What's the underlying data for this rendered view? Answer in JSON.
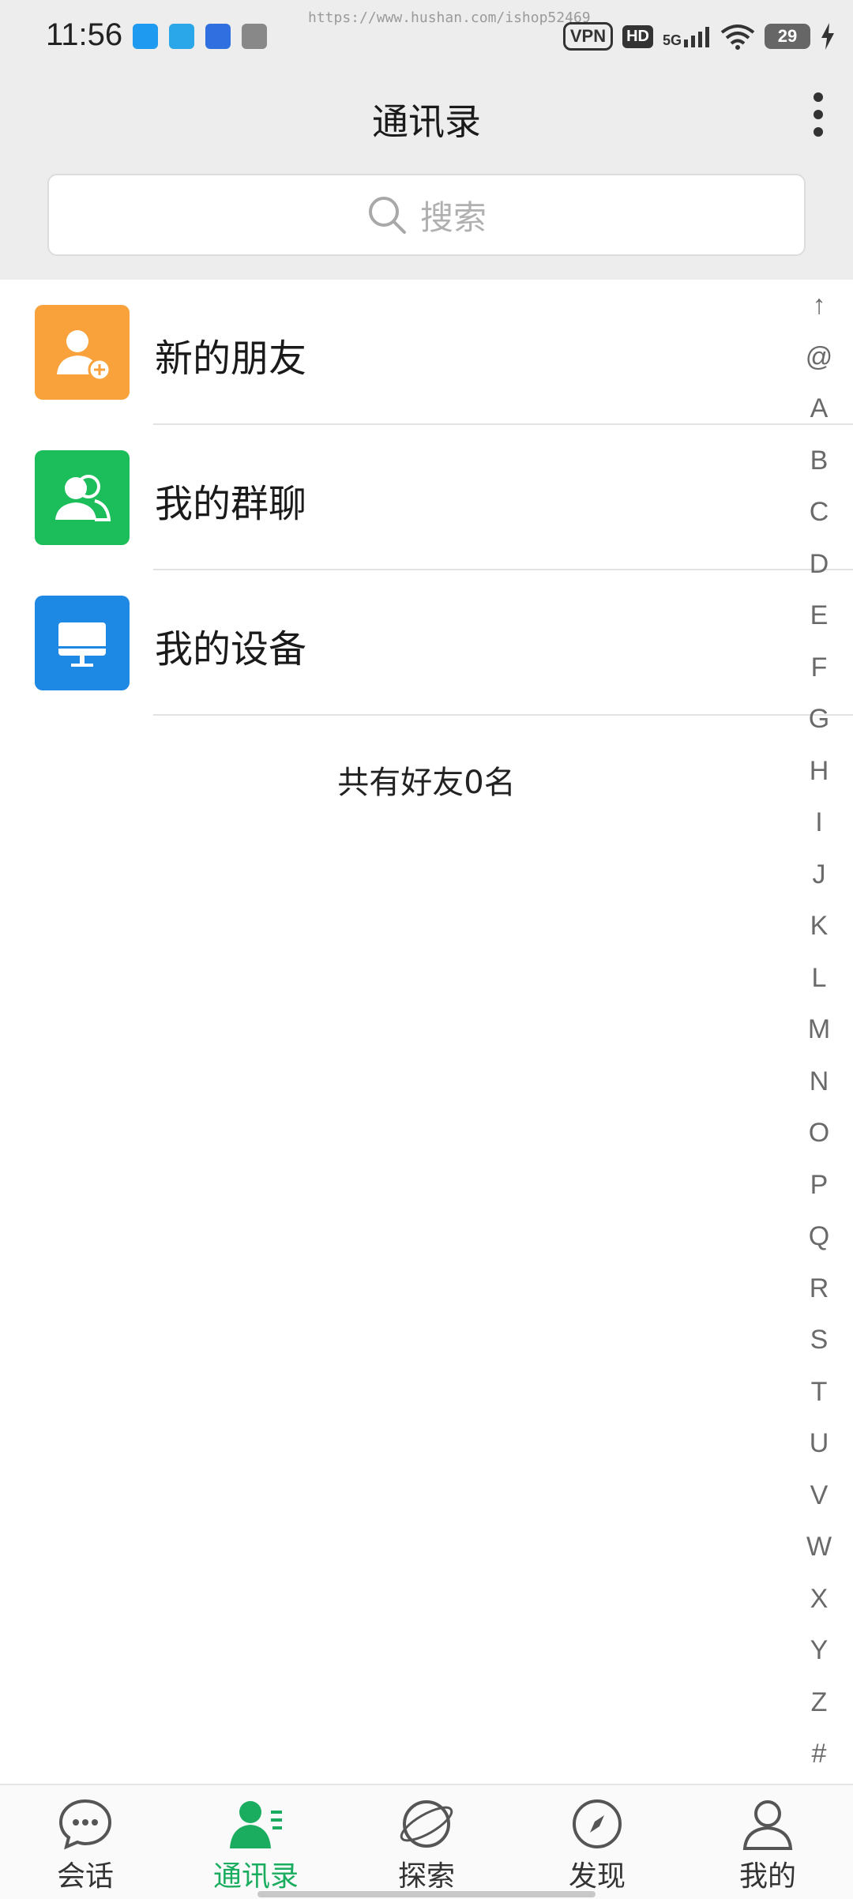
{
  "status_bar": {
    "time": "11:56",
    "watermark": "https://www.hushan.com/ishop52469",
    "vpn": "VPN",
    "hd": "HD",
    "network": "5G",
    "battery": "29"
  },
  "header": {
    "title": "通讯录",
    "search_placeholder": "搜索"
  },
  "list": [
    {
      "label": "新的朋友",
      "icon": "add-friend-icon",
      "color": "#f9a23b"
    },
    {
      "label": "我的群聊",
      "icon": "group-chat-icon",
      "color": "#1bbe5a"
    },
    {
      "label": "我的设备",
      "icon": "device-icon",
      "color": "#1e88e5"
    }
  ],
  "friend_count": "共有好友0名",
  "index_bar": [
    "↑",
    "@",
    "A",
    "B",
    "C",
    "D",
    "E",
    "F",
    "G",
    "H",
    "I",
    "J",
    "K",
    "L",
    "M",
    "N",
    "O",
    "P",
    "Q",
    "R",
    "S",
    "T",
    "U",
    "V",
    "W",
    "X",
    "Y",
    "Z",
    "#"
  ],
  "bottom_nav": [
    {
      "label": "会话",
      "icon": "chat-bubble-icon",
      "active": false
    },
    {
      "label": "通讯录",
      "icon": "contacts-icon",
      "active": true
    },
    {
      "label": "探索",
      "icon": "planet-icon",
      "active": false
    },
    {
      "label": "发现",
      "icon": "compass-icon",
      "active": false
    },
    {
      "label": "我的",
      "icon": "profile-icon",
      "active": false
    }
  ],
  "colors": {
    "accent": "#1aad5f",
    "header_bg": "#ededed"
  }
}
